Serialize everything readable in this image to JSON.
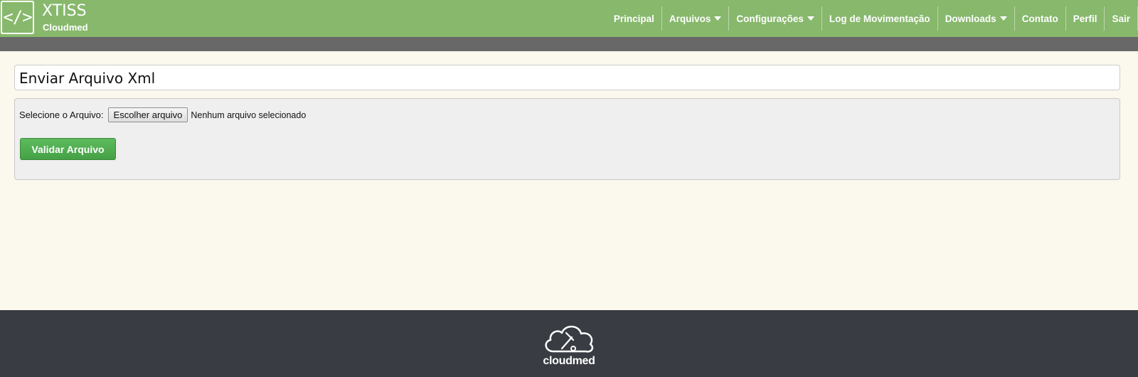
{
  "header": {
    "logo_symbol": "</>",
    "title": "XTISS",
    "subtitle": "Cloudmed",
    "nav": [
      {
        "label": "Principal",
        "dropdown": false
      },
      {
        "label": "Arquivos",
        "dropdown": true
      },
      {
        "label": "Configurações",
        "dropdown": true
      },
      {
        "label": "Log de Movimentação",
        "dropdown": false
      },
      {
        "label": "Downloads",
        "dropdown": true
      },
      {
        "label": "Contato",
        "dropdown": false
      },
      {
        "label": "Perfil",
        "dropdown": false
      },
      {
        "label": "Sair",
        "dropdown": false
      }
    ]
  },
  "page": {
    "title": "Enviar Arquivo Xml",
    "file_label": "Selecione o Arquivo:",
    "file_button": "Escolher arquivo",
    "file_status": "Nenhum arquivo selecionado",
    "submit_label": "Validar Arquivo"
  },
  "footer": {
    "brand": "cloudmed",
    "icon": "cloud-stethoscope-icon"
  },
  "colors": {
    "header": "#87b86c",
    "subbar": "#686868",
    "page_bg": "#fbf8ee",
    "button_green": "#4cae4c",
    "footer": "#393c42"
  }
}
